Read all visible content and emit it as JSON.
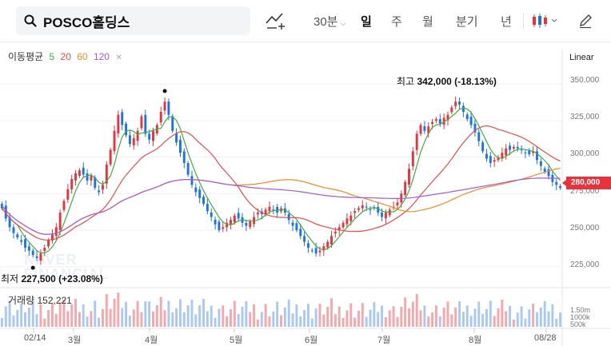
{
  "stock": {
    "name": "POSCO홀딩스"
  },
  "toolbar": {
    "interval": "30분",
    "tabs": [
      "일",
      "주",
      "월",
      "분기",
      "년"
    ],
    "active_tab": "일"
  },
  "legend": {
    "label": "이동평균",
    "periods": [
      "5",
      "20",
      "60",
      "120"
    ],
    "colors": [
      "#3fae3f",
      "#e84c4c",
      "#f08a24",
      "#a55bd8"
    ]
  },
  "scale": {
    "mode": "Linear"
  },
  "price_axis": [
    "350,000",
    "325,000",
    "300,000",
    "275,000",
    "250,000",
    "225,000"
  ],
  "current_price": "280,000",
  "annotations": {
    "high": {
      "label": "최고",
      "value": "342,000 (-18.13%)"
    },
    "low": {
      "label": "최저",
      "value": "227,500 (+23.08%)"
    }
  },
  "volume": {
    "label": "거래량",
    "value": "152,221",
    "axis": [
      "1.50m",
      "1000k",
      "500k"
    ]
  },
  "date_axis": [
    "02/14",
    "3월",
    "4월",
    "5월",
    "6월",
    "7월",
    "8월",
    "08/28"
  ],
  "colors": {
    "up": "#e8333c",
    "down": "#1a73e8",
    "accent_red": "#e8333c"
  },
  "watermark": [
    "NAVER",
    "FINANCIAL"
  ],
  "chart_data": {
    "type": "candlestick",
    "ylim": [
      215000,
      360000
    ],
    "closes": [
      265000,
      258000,
      252000,
      248000,
      245000,
      242000,
      238000,
      236000,
      233000,
      231000,
      234000,
      238000,
      243000,
      247000,
      252000,
      262000,
      270000,
      278000,
      285000,
      289000,
      291000,
      288000,
      284000,
      287000,
      279000,
      276000,
      281000,
      295000,
      305000,
      318000,
      329000,
      322000,
      315000,
      309000,
      313000,
      318000,
      328000,
      316000,
      312000,
      318000,
      322000,
      331000,
      338000,
      329000,
      318000,
      310000,
      303000,
      296000,
      288000,
      281000,
      276000,
      272000,
      268000,
      263000,
      259000,
      254000,
      250000,
      252000,
      255000,
      257000,
      260000,
      258000,
      255000,
      253000,
      256000,
      259000,
      262000,
      261000,
      264000,
      266000,
      264000,
      262000,
      265000,
      262000,
      257000,
      253000,
      250000,
      246000,
      242000,
      238000,
      236000,
      234000,
      236000,
      239000,
      242000,
      246000,
      249000,
      252000,
      255000,
      258000,
      260000,
      263000,
      265000,
      267000,
      266000,
      264000,
      265000,
      262000,
      259000,
      262000,
      264000,
      266000,
      269000,
      275000,
      283000,
      292000,
      304000,
      316000,
      322000,
      318000,
      321000,
      324000,
      326000,
      323000,
      327000,
      329000,
      334000,
      338000,
      336000,
      331000,
      326000,
      322000,
      317000,
      311000,
      304000,
      299000,
      296000,
      298000,
      300000,
      303000,
      306000,
      305000,
      307000,
      306000,
      305000,
      303000,
      302000,
      304000,
      298000,
      294000,
      290000,
      287000,
      283000,
      281000,
      279000
    ],
    "ma_periods": [
      5,
      20,
      60,
      120
    ]
  }
}
